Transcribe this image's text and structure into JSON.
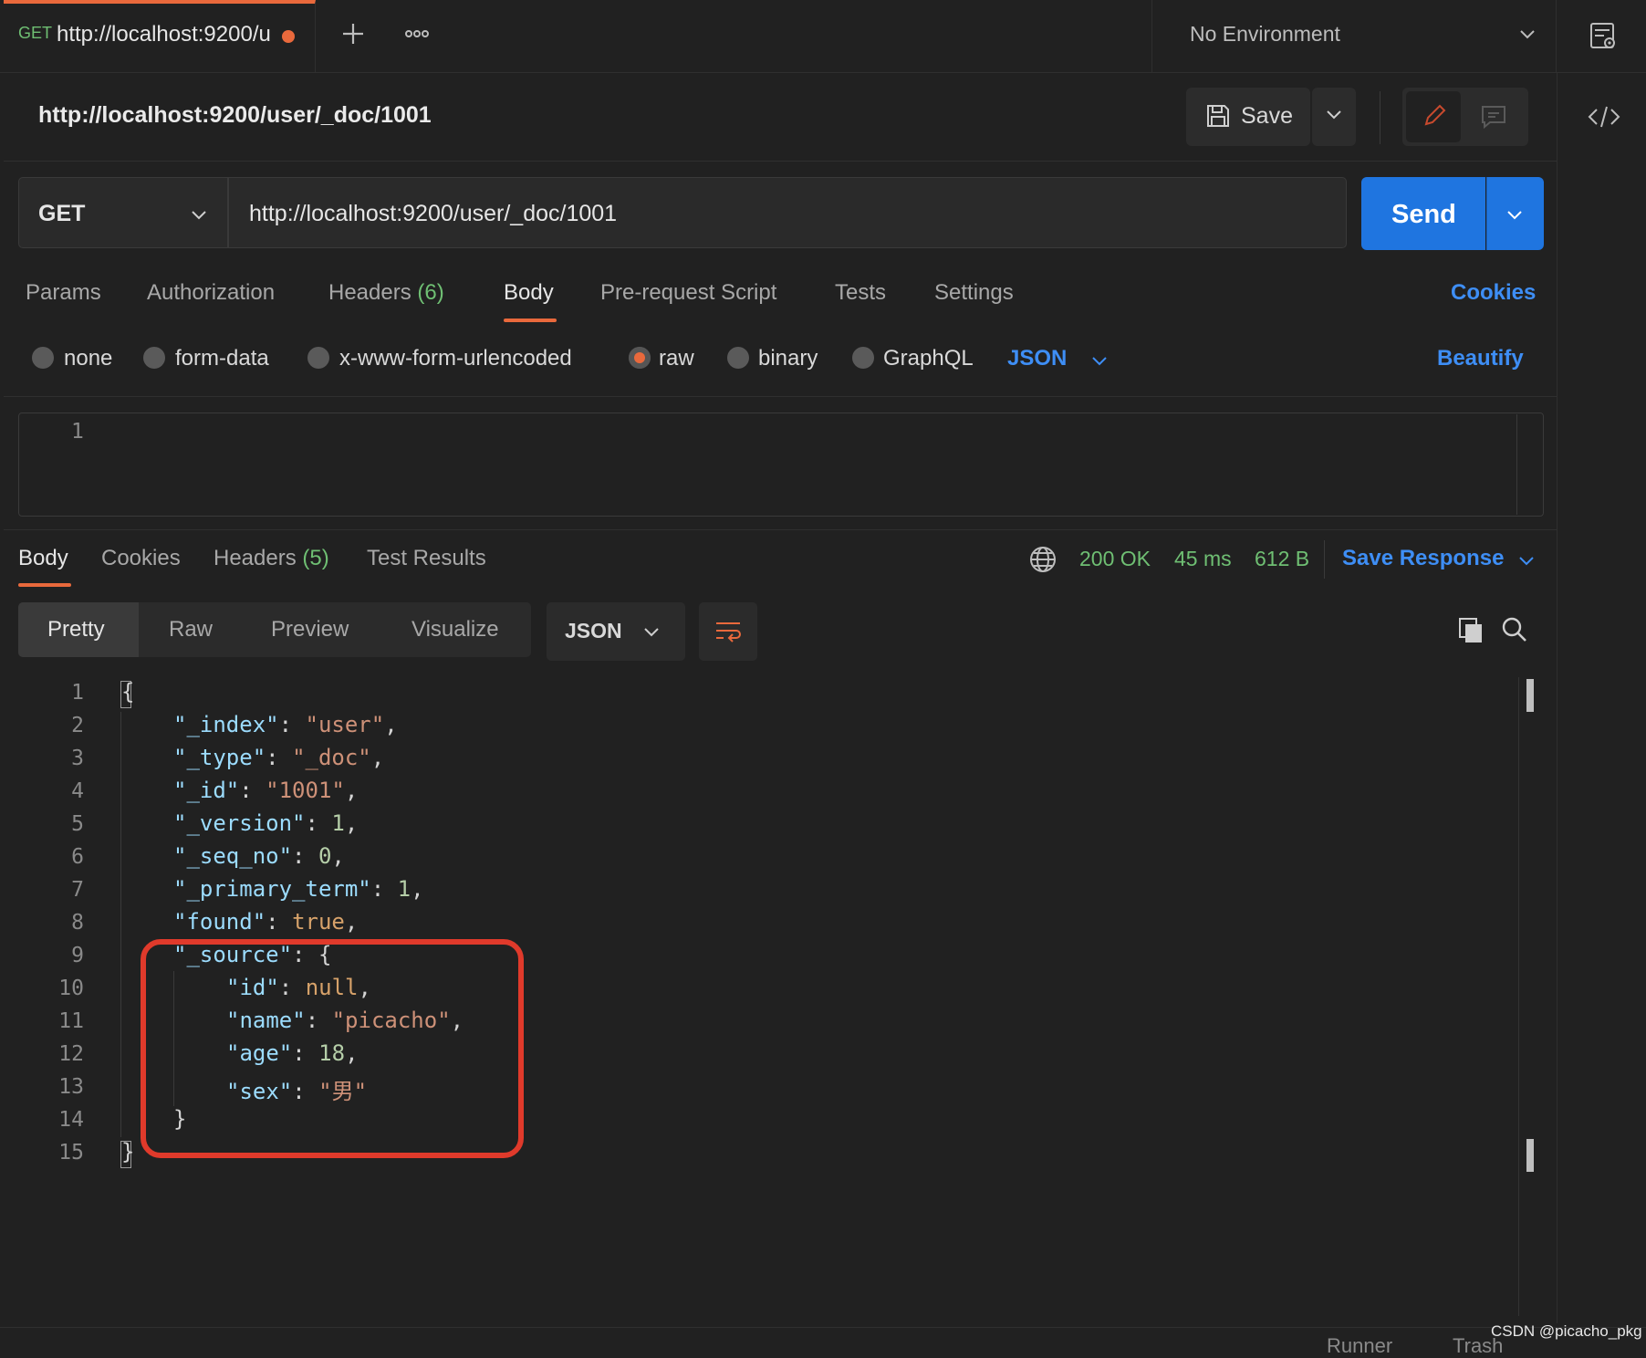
{
  "tab": {
    "method": "GET",
    "title": "http://localhost:9200/u"
  },
  "environment": {
    "label": "No Environment"
  },
  "request": {
    "title": "http://localhost:9200/user/_doc/1001",
    "save_label": "Save",
    "method": "GET",
    "url": "http://localhost:9200/user/_doc/1001",
    "send_label": "Send",
    "tabs": {
      "params": "Params",
      "authorization": "Authorization",
      "headers": "Headers",
      "headers_count": "(6)",
      "body": "Body",
      "prerequest": "Pre-request Script",
      "tests": "Tests",
      "settings": "Settings"
    },
    "cookies_link": "Cookies",
    "body_types": {
      "none": "none",
      "form_data": "form-data",
      "urlencoded": "x-www-form-urlencoded",
      "raw": "raw",
      "binary": "binary",
      "graphql": "GraphQL"
    },
    "body_format": "JSON",
    "beautify": "Beautify",
    "editor_line": "1"
  },
  "response": {
    "tabs": {
      "body": "Body",
      "cookies": "Cookies",
      "headers": "Headers",
      "headers_count": "(5)",
      "test_results": "Test Results"
    },
    "status": "200 OK",
    "time": "45 ms",
    "size": "612 B",
    "save_response": "Save Response",
    "views": {
      "pretty": "Pretty",
      "raw": "Raw",
      "preview": "Preview",
      "visualize": "Visualize"
    },
    "format": "JSON",
    "line_numbers": [
      "1",
      "2",
      "3",
      "4",
      "5",
      "6",
      "7",
      "8",
      "9",
      "10",
      "11",
      "12",
      "13",
      "14",
      "15"
    ],
    "json": {
      "open_brace": "{",
      "close_brace": "}",
      "index_key": "\"_index\"",
      "index_val": "\"user\"",
      "type_key": "\"_type\"",
      "type_val": "\"_doc\"",
      "id_key": "\"_id\"",
      "id_val": "\"1001\"",
      "version_key": "\"_version\"",
      "version_val": "1",
      "seq_key": "\"_seq_no\"",
      "seq_val": "0",
      "term_key": "\"_primary_term\"",
      "term_val": "1",
      "found_key": "\"found\"",
      "found_val": "true",
      "source_key": "\"_source\"",
      "src_id_key": "\"id\"",
      "src_id_val": "null",
      "src_name_key": "\"name\"",
      "src_name_val": "\"picacho\"",
      "src_age_key": "\"age\"",
      "src_age_val": "18",
      "src_sex_key": "\"sex\"",
      "src_sex_val": "\"男\""
    }
  },
  "footer": {
    "runner": "Runner",
    "trash": "Trash"
  },
  "watermark": "CSDN @picacho_pkg",
  "colors": {
    "accent": "#e9693c",
    "send": "#1f75e0",
    "link": "#3e8ef5",
    "status": "#6fbf73",
    "highlight": "#e03a2b"
  }
}
